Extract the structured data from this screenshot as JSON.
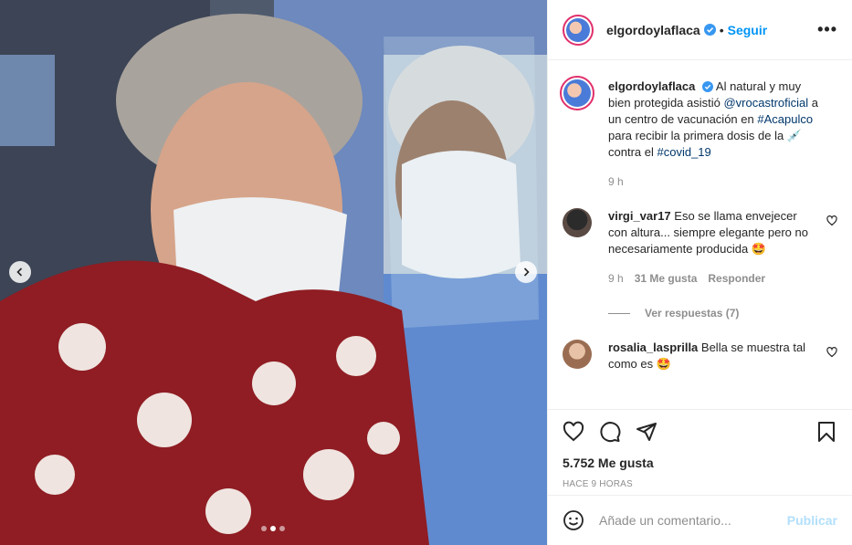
{
  "header": {
    "username": "elgordoylaflaca",
    "separator": "•",
    "follow_label": "Seguir",
    "more_label": "•••"
  },
  "caption": {
    "username": "elgordoylaflaca",
    "text_1": "Al natural y muy bien protegida asistió",
    "mention": "@vrocastroficial",
    "text_2": "a un centro de vacunación en",
    "hashtag_1": "#Acapulco",
    "text_3": "para recibir la primera dosis de la",
    "emoji": "💉",
    "text_4": "contra el",
    "hashtag_2": "#covid_19",
    "time": "9 h"
  },
  "comments": [
    {
      "username": "virgi_var17",
      "text": "Eso se llama envejecer con altura... siempre elegante pero no necesariamente producida 🤩",
      "time": "9 h",
      "likes": "31 Me gusta",
      "reply": "Responder",
      "view_replies": "Ver respuestas (7)"
    },
    {
      "username": "rosalia_lasprilla",
      "text": "Bella se muestra tal como es 🤩"
    }
  ],
  "actions": {
    "likes": "5.752 Me gusta",
    "posted_ago": "HACE 9 HORAS"
  },
  "add_comment": {
    "placeholder": "Añade un comentario...",
    "publish_label": "Publicar"
  },
  "colors": {
    "link": "#00376b",
    "accent": "#0095f6",
    "publish_disabled": "#b2dffc",
    "muted": "#8e8e8e"
  },
  "carousel": {
    "slide_count": 3,
    "active_slide": 2
  }
}
